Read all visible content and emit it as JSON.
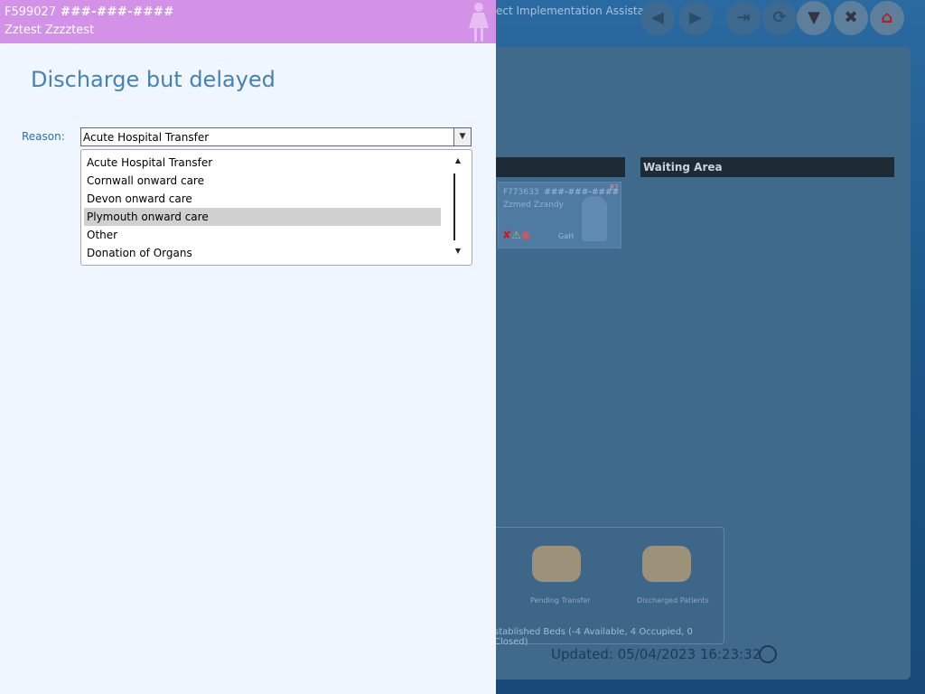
{
  "background": {
    "app_title": "ect Implementation Assistant",
    "sections": [
      {
        "label": ""
      },
      {
        "label": "Waiting Area"
      }
    ],
    "patient_card": {
      "id": "F773633",
      "nhs": "###-###-####",
      "name": "Zzmed Zzandy",
      "age": "82",
      "tag": "GaH"
    },
    "tray": {
      "pending_label": "Pending Transfer",
      "discharged_label": "Discharged Patients",
      "status": "stablished Beds (-4 Available, 4 Occupied, 0 Closed)"
    },
    "updated": "Updated: 05/04/2023 16:23:32"
  },
  "patient_header": {
    "id": "F599027",
    "nhs_number": "###-###-####",
    "name": "Zztest Zzzztest",
    "gender_icon": "female-figure-icon"
  },
  "form": {
    "title": "Discharge but delayed",
    "reason_label": "Reason:",
    "reason_value": "Acute Hospital Transfer",
    "options": [
      "Acute Hospital Transfer",
      "Cornwall onward care",
      "Devon onward care",
      "Plymouth onward care",
      "Other",
      "Donation of Organs"
    ],
    "highlighted_option": "Plymouth onward care"
  },
  "colors": {
    "header_bg": "#d391e8",
    "panel_bg": "#eff6ff",
    "title_color": "#4682b4"
  }
}
